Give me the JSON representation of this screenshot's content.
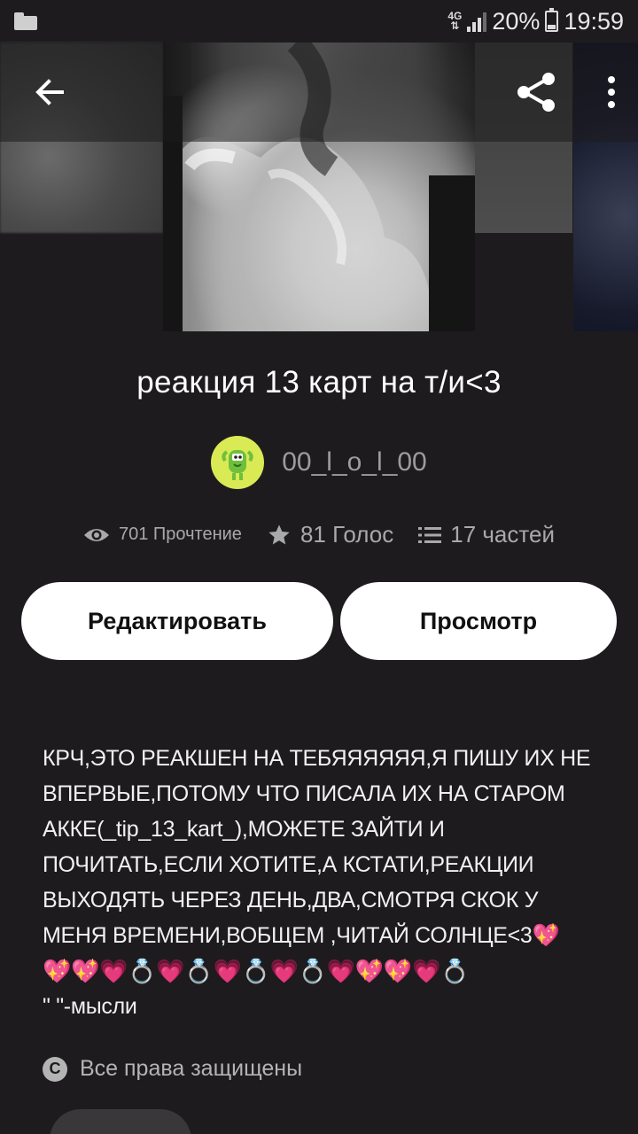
{
  "status_bar": {
    "network": "4G",
    "battery_percent": "20%",
    "time": "19:59"
  },
  "story": {
    "title": "реакция 13 карт на т/и<3",
    "author": "00_l_o_l_00"
  },
  "stats": {
    "reads": "701 Прочтение",
    "votes": "81 Голос",
    "parts": "17 частей"
  },
  "actions": {
    "edit_label": "Редактировать",
    "view_label": "Просмотр"
  },
  "description": {
    "text": "КРЧ,ЭТО РЕАКШЕН НА ТЕБЯЯЯЯЯЯ,Я ПИШУ ИХ НЕ ВПЕРВЫЕ,ПОТОМУ ЧТО ПИСАЛА ИХ НА СТАРОМ АККЕ(_tip_13_kart_),МОЖЕТЕ ЗАЙТИ И ПОЧИТАТЬ,ЕСЛИ ХОТИТЕ,А КСТАТИ,РЕАКЦИИ ВЫХОДЯТЬ ЧЕРЕЗ ДЕНЬ,ДВА,СМОТРЯ СКОК У МЕНЯ ВРЕМЕНИ,ВОБЩЕМ ,ЧИТАЙ СОЛНЦЕ<3💖",
    "emojis": "💖💖💗💍💗💍💗💍💗💍💗💖💖💗💍",
    "thoughts_note": "\" \"-мысли"
  },
  "copyright": "Все права защищены",
  "icons": {
    "back": "arrow-left-icon",
    "share": "share-icon",
    "more": "more-vertical-icon",
    "eye": "eye-icon",
    "star": "star-icon",
    "list": "list-icon",
    "copyright": "copyright-icon"
  }
}
